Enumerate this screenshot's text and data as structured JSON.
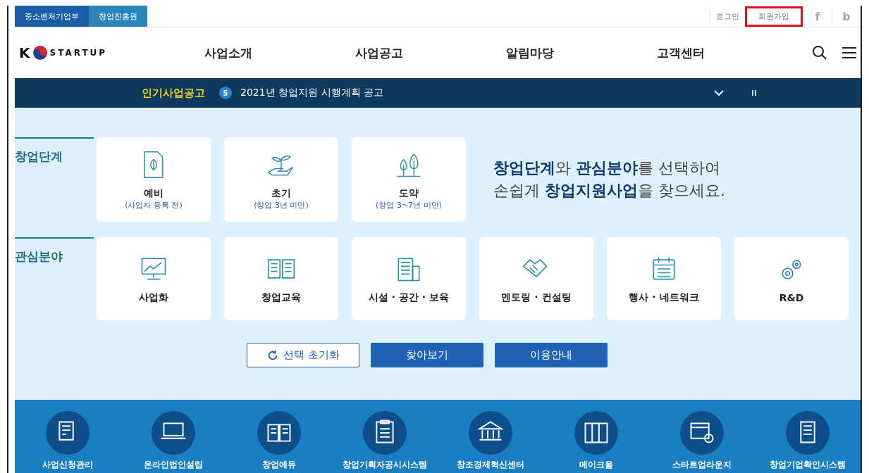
{
  "top_bar": {
    "agencies": [
      {
        "label": "중소벤처기업부",
        "selected": true
      },
      {
        "label": "창업진흥원",
        "selected": false
      }
    ],
    "links": [
      {
        "label": "로그인",
        "highlighted": false
      },
      {
        "label": "회원가입",
        "highlighted": true
      }
    ],
    "social": [
      "f",
      "b"
    ]
  },
  "nav": {
    "logo_letter": "K",
    "logo_text": "STARTUP",
    "menu": [
      "사업소개",
      "사업공고",
      "알림마당",
      "고객센터"
    ]
  },
  "ticker": {
    "label": "인기사업공고",
    "number": "5",
    "text": "2021년 창업지원 시행계획 공고"
  },
  "stage": {
    "heading": "창업단계",
    "cards": [
      {
        "kind": "doc",
        "title": "예비",
        "sub": "(사업자 등록 전)"
      },
      {
        "kind": "sprout",
        "title": "초기",
        "sub": "(창업 3년 미만)"
      },
      {
        "kind": "trees",
        "title": "도약",
        "sub": "(창업 3~7년 미만)"
      }
    ]
  },
  "headline": [
    "**창업단계**와 **관심분야**를 선택하여",
    "손쉽게 **창업지원사업**을 찾으세요."
  ],
  "interest": {
    "heading": "관심분야",
    "cards": [
      {
        "kind": "monitor",
        "label": "사업화"
      },
      {
        "kind": "book",
        "label": "창업교육"
      },
      {
        "kind": "building",
        "label": "시설 · 공간 · 보육"
      },
      {
        "kind": "handshake",
        "label": "멘토링 · 컨설팅"
      },
      {
        "kind": "calendar",
        "label": "행사 · 네트워크"
      },
      {
        "kind": "gears",
        "label": "R&D"
      }
    ]
  },
  "buttons": [
    {
      "kind": "outline",
      "label": "선택 초기화"
    },
    {
      "kind": "primary",
      "label": "찾아보기"
    },
    {
      "kind": "primary",
      "label": "이용안내"
    }
  ],
  "services": [
    {
      "kind": "form",
      "label": "사업신청관리"
    },
    {
      "kind": "laptop",
      "label": "온라인법인설립"
    },
    {
      "kind": "book",
      "label": "창업에듀"
    },
    {
      "kind": "clipboard",
      "label": "창업기획자공시시스템"
    },
    {
      "kind": "bank",
      "label": "창조경제혁신센터"
    },
    {
      "kind": "shelf",
      "label": "메이크올"
    },
    {
      "kind": "calendar",
      "label": "스타트업라운지"
    },
    {
      "kind": "list",
      "label": "창업기업확인시스템"
    }
  ]
}
